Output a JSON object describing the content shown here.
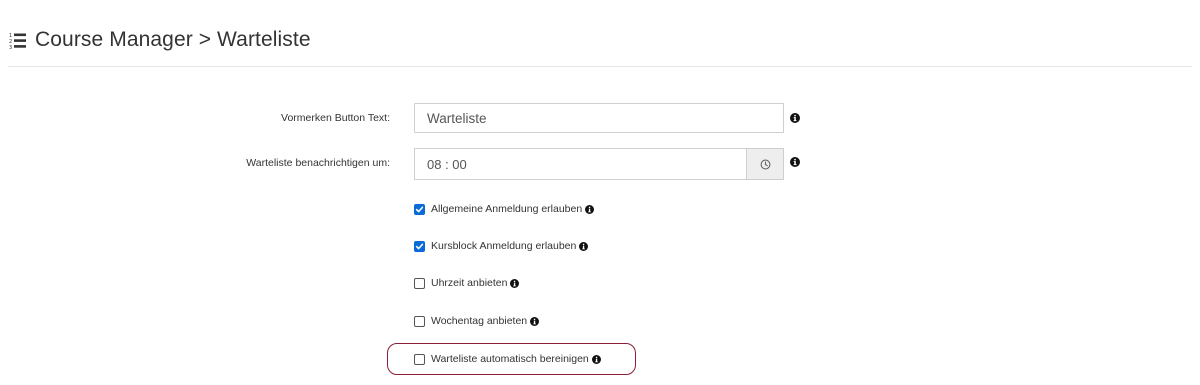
{
  "header": {
    "title": "Course Manager > Warteliste",
    "icon": "list-ordered-icon"
  },
  "form": {
    "button_text_label": "Vormerken Button Text:",
    "button_text_value": "Warteliste",
    "notify_label": "Warteliste benachrichtigen um:",
    "notify_value": "08 : 00",
    "time_icon": "clock-icon",
    "info_icon": "info-circle-icon"
  },
  "options": [
    {
      "label": "Allgemeine Anmeldung erlauben",
      "checked": true
    },
    {
      "label": "Kursblock Anmeldung erlauben",
      "checked": true
    },
    {
      "label": "Uhrzeit anbieten",
      "checked": false
    },
    {
      "label": "Wochentag anbieten",
      "checked": false
    },
    {
      "label": "Warteliste automatisch bereinigen",
      "checked": false
    }
  ],
  "colors": {
    "checkbox_checked": "#0b6bd6",
    "highlight_outline": "#8a1f35"
  }
}
